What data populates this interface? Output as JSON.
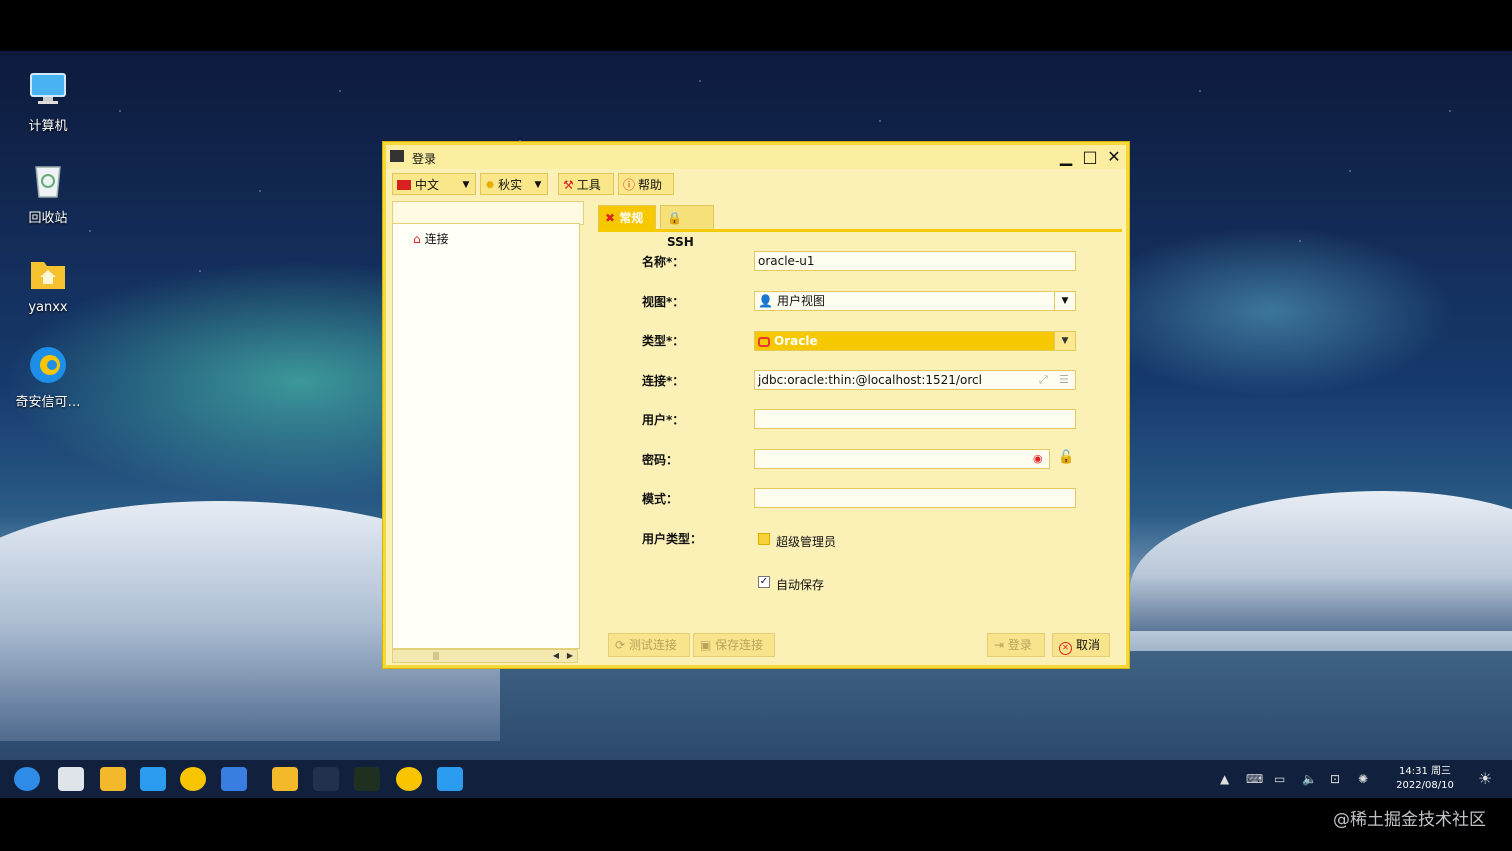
{
  "desktop": {
    "icons": [
      {
        "label": "计算机",
        "icon": "computer-icon"
      },
      {
        "label": "回收站",
        "icon": "trash-icon"
      },
      {
        "label": "yanxx",
        "icon": "home-folder-icon"
      },
      {
        "label": "奇安信可…",
        "icon": "browser-icon"
      }
    ]
  },
  "dialog": {
    "title": "登录",
    "toolbar": {
      "language": "中文",
      "theme": "秋实",
      "tools": "工具",
      "help": "帮助"
    },
    "tree": {
      "search_value": "",
      "root_label": "连接"
    },
    "tabs": [
      "常规",
      "SSH"
    ],
    "form": {
      "name_label": "名称*：",
      "name_value": "oracle-u1",
      "view_label": "视图*：",
      "view_value": "用户视图",
      "type_label": "类型*：",
      "type_value": "Oracle",
      "conn_label": "连接*：",
      "conn_value": "jdbc:oracle:thin:@localhost:1521/orcl",
      "user_label": "用户*：",
      "user_value": "",
      "password_label": "密码：",
      "password_value": "",
      "schema_label": "模式：",
      "schema_value": "",
      "usertype_label": "用户类型：",
      "superadmin_label": "超级管理员",
      "superadmin_checked": false,
      "autosave_label": "自动保存",
      "autosave_checked": true
    },
    "buttons": {
      "test": "测试连接",
      "save": "保存连接",
      "login": "登录",
      "cancel": "取消"
    }
  },
  "taskbar": {
    "clock_time": "14:31 周三",
    "clock_date": "2022/08/10"
  },
  "watermark": "@稀土掘金技术社区",
  "colors": {
    "accent": "#f5c800",
    "dialog_bg": "#fbf1b6",
    "taskbar_bg": "#11213d"
  }
}
